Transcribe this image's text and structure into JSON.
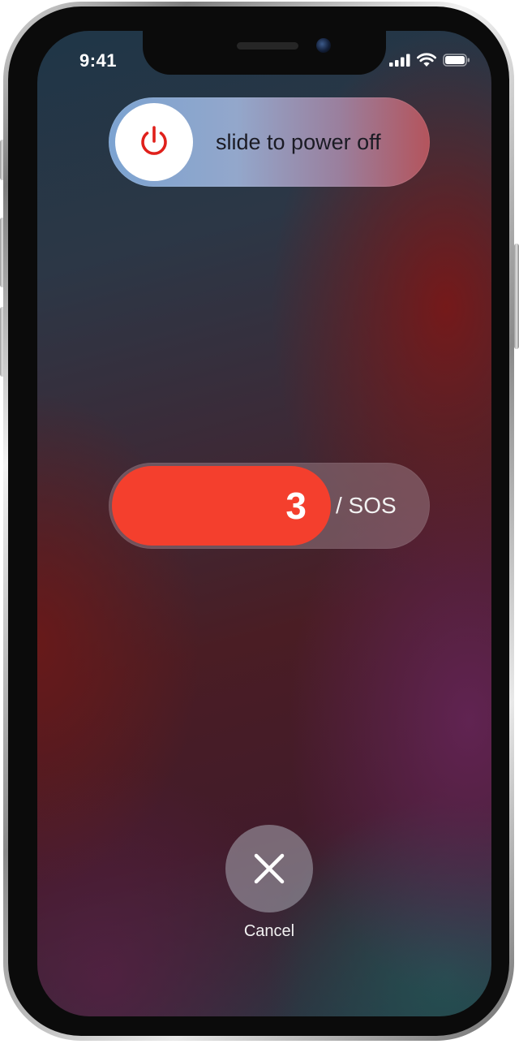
{
  "status_bar": {
    "time": "9:41",
    "icons": [
      "cellular-signal-icon",
      "wifi-icon",
      "battery-icon"
    ]
  },
  "power_off": {
    "label": "slide to power off",
    "icon": "power-icon",
    "icon_color": "#e0201b"
  },
  "sos": {
    "visible_label": "/ SOS",
    "countdown": "3",
    "accent_color": "#f43f2d"
  },
  "cancel": {
    "icon": "close-icon",
    "label": "Cancel"
  }
}
